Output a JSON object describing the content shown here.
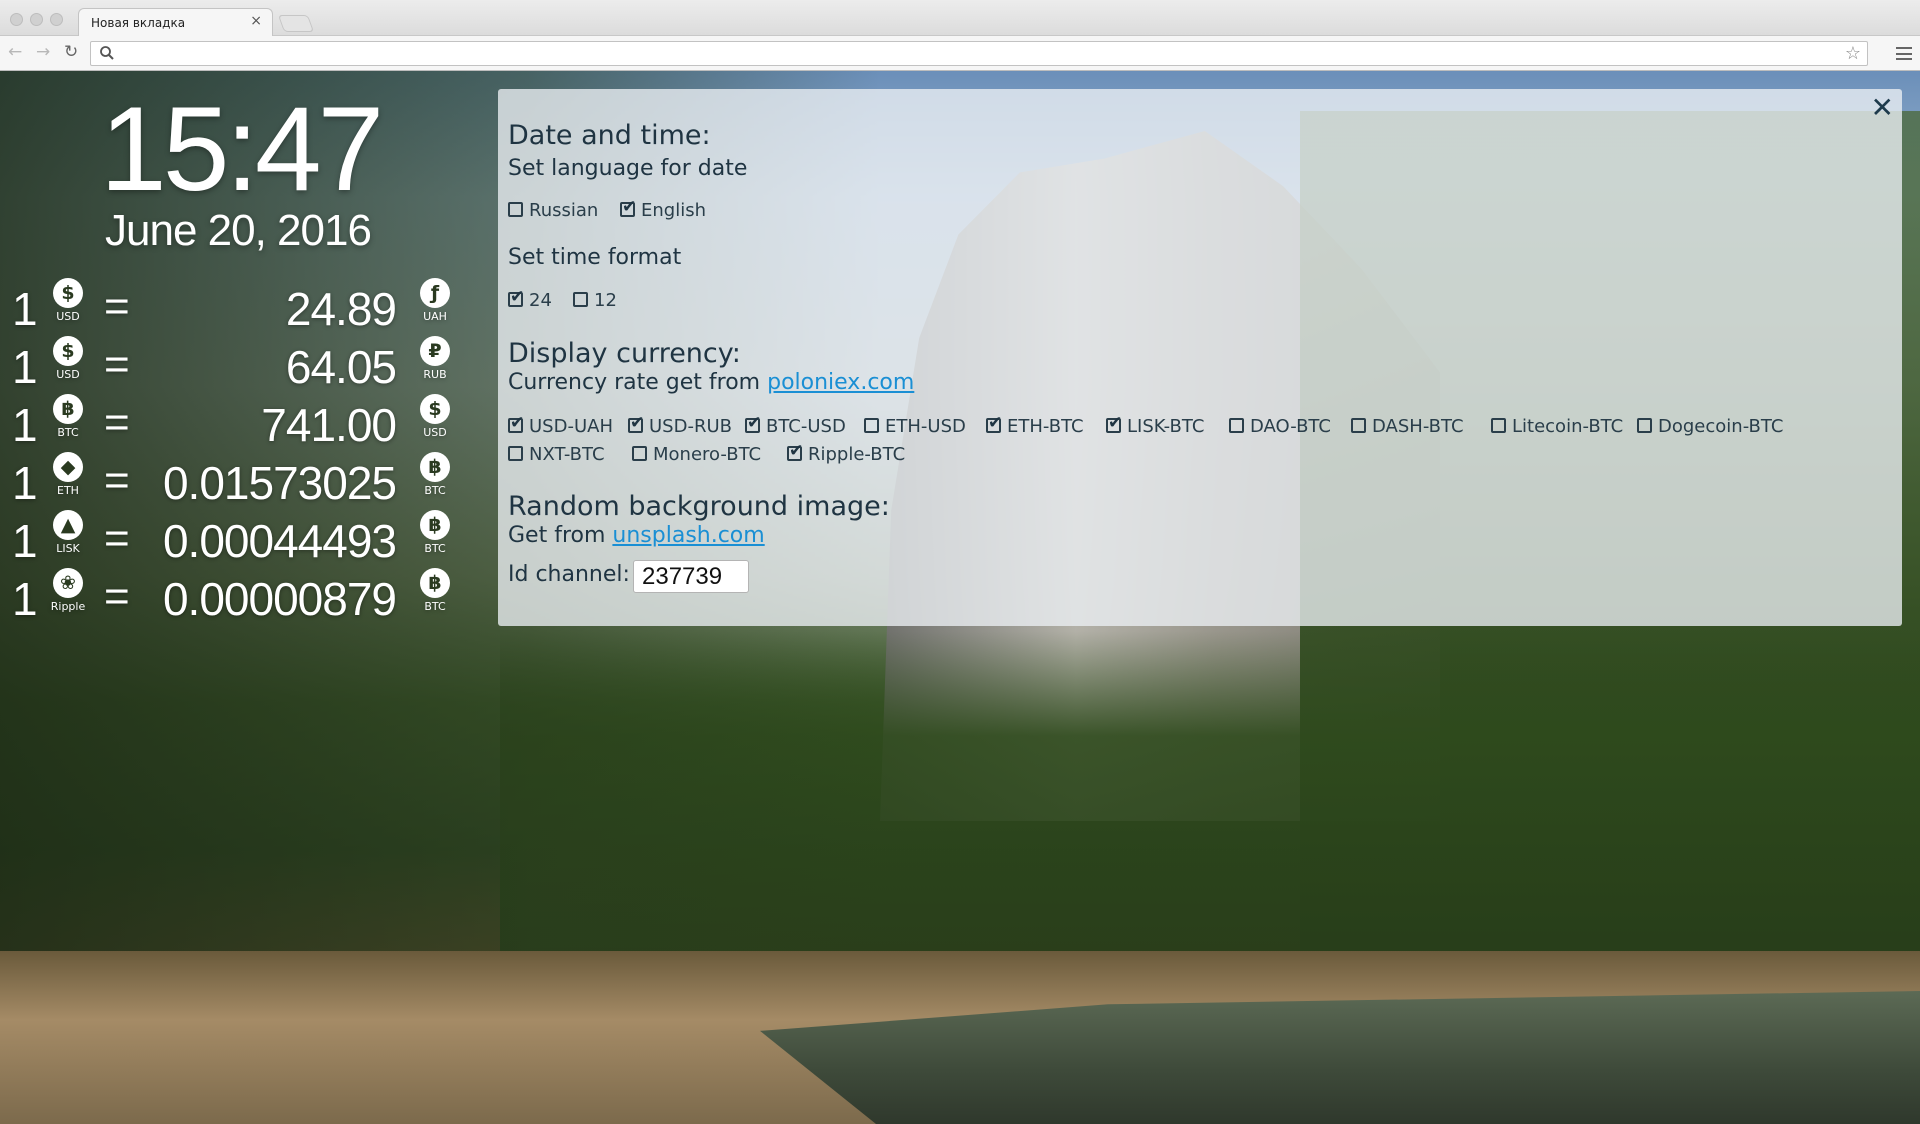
{
  "browser": {
    "tab_title": "Новая вкладка",
    "tab_close": "×",
    "omnibox_value": ""
  },
  "widget": {
    "time": "15:47",
    "date": "June 20, 2016",
    "eq": "=",
    "rates": [
      {
        "amount": "1",
        "from_code": "USD",
        "from_icon": "dollar-icon",
        "value": "24.89",
        "to_code": "UAH",
        "to_icon": "hryvnia-icon"
      },
      {
        "amount": "1",
        "from_code": "USD",
        "from_icon": "dollar-icon",
        "value": "64.05",
        "to_code": "RUB",
        "to_icon": "ruble-icon"
      },
      {
        "amount": "1",
        "from_code": "BTC",
        "from_icon": "bitcoin-icon",
        "value": "741.00",
        "to_code": "USD",
        "to_icon": "dollar-icon"
      },
      {
        "amount": "1",
        "from_code": "ETH",
        "from_icon": "ethereum-icon",
        "value": "0.01573025",
        "to_code": "BTC",
        "to_icon": "bitcoin-icon"
      },
      {
        "amount": "1",
        "from_code": "LISK",
        "from_icon": "lisk-icon",
        "value": "0.00044493",
        "to_code": "BTC",
        "to_icon": "bitcoin-icon"
      },
      {
        "amount": "1",
        "from_code": "Ripple",
        "from_icon": "ripple-icon",
        "value": "0.00000879",
        "to_code": "BTC",
        "to_icon": "bitcoin-icon"
      }
    ]
  },
  "settings": {
    "close": "✕",
    "datetime_heading": "Date and time:",
    "language_heading": "Set language for date",
    "languages": [
      {
        "label": "Russian",
        "checked": false
      },
      {
        "label": "English",
        "checked": true
      }
    ],
    "time_format_heading": "Set time format",
    "time_formats": [
      {
        "label": "24",
        "checked": true
      },
      {
        "label": "12",
        "checked": false
      }
    ],
    "currency_heading": "Display currency:",
    "currency_source_prefix": "Currency rate get from ",
    "currency_source_link": "poloniex.com",
    "currencies": [
      {
        "label": "USD-UAH",
        "checked": true
      },
      {
        "label": "USD-RUB",
        "checked": true
      },
      {
        "label": "BTC-USD",
        "checked": true
      },
      {
        "label": "ETH-USD",
        "checked": false
      },
      {
        "label": "ETH-BTC",
        "checked": true
      },
      {
        "label": "LISK-BTC",
        "checked": true
      },
      {
        "label": "DAO-BTC",
        "checked": false
      },
      {
        "label": "DASH-BTC",
        "checked": false
      },
      {
        "label": "Litecoin-BTC",
        "checked": false
      },
      {
        "label": "Dogecoin-BTC",
        "checked": false
      },
      {
        "label": "NXT-BTC",
        "checked": false
      },
      {
        "label": "Monero-BTC",
        "checked": false
      },
      {
        "label": "Ripple-BTC",
        "checked": true
      }
    ],
    "background_heading": "Random background image:",
    "background_source_prefix": "Get from ",
    "background_source_link": "unsplash.com",
    "id_channel_label": "Id channel:",
    "id_channel_value": "237739"
  }
}
